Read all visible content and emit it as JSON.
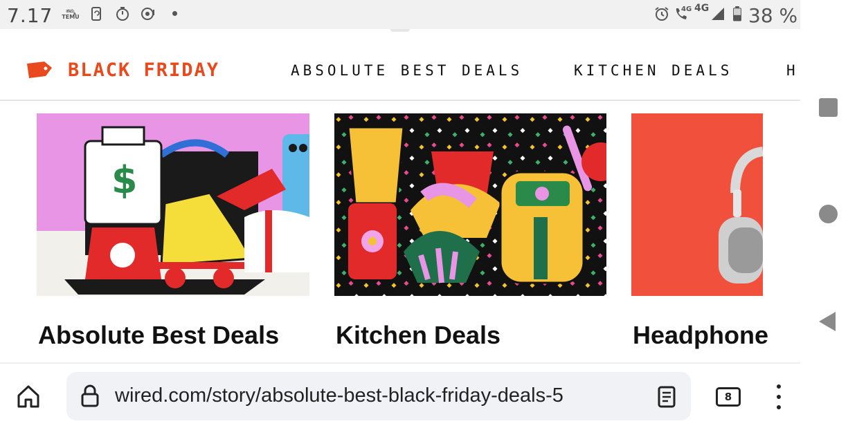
{
  "status_bar": {
    "time": "7.17",
    "temu_badge_top": "ತಮ್ಮ",
    "temu_badge_bottom": "TEMU",
    "network_small": "4G",
    "network_main": "4G",
    "battery": "38 %",
    "icons": [
      "temu-icon",
      "phone-sync-icon",
      "stopwatch-icon",
      "audio-icon",
      "notification-dot",
      "alarm-icon",
      "wifi-calling-icon",
      "signal-icon",
      "battery-icon"
    ]
  },
  "header": {
    "brand": "BLACK FRIDAY",
    "nav_links": [
      "ABSOLUTE BEST DEALS",
      "KITCHEN DEALS",
      "H"
    ],
    "accent_color": "#e8491d"
  },
  "cards": [
    {
      "title": "Absolute Best Deals",
      "image": "illustration-blender-skates-mixer"
    },
    {
      "title": "Kitchen Deals",
      "image": "illustration-kitchen-appliances"
    },
    {
      "title": "Headphone",
      "image": "photo-headphones-on-red"
    }
  ],
  "browser": {
    "url": "wired.com/story/absolute-best-black-friday-deals-5",
    "tab_count": "8"
  }
}
